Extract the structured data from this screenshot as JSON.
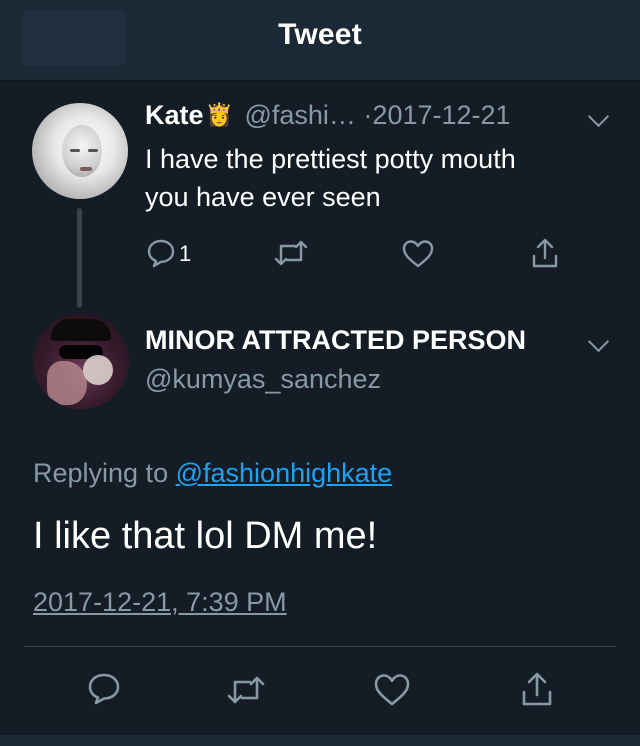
{
  "header": {
    "title": "Tweet"
  },
  "parent_tweet": {
    "name": "Kate",
    "badge_emoji": "👸",
    "handle": "@fashi…",
    "separator": "·",
    "date": "2017-12-21",
    "text": "I have the prettiest potty mouth you have ever seen",
    "reply_count": "1"
  },
  "main_tweet": {
    "name": "MINOR ATTRACTED PERSON",
    "handle": "@kumyas_sanchez",
    "replying_prefix": "Replying to",
    "replying_handle": "@fashionhighkate",
    "text": "I like that lol DM me!",
    "timestamp": "2017-12-21, 7:39 PM"
  },
  "icons": {
    "reply": "reply-icon",
    "retweet": "retweet-icon",
    "like": "heart-icon",
    "share": "share-icon",
    "more": "chevron-down-icon"
  },
  "colors": {
    "background": "#141d26",
    "header": "#1b2836",
    "muted": "#8899a6",
    "link": "#1da1f2",
    "divider": "#38444d"
  }
}
